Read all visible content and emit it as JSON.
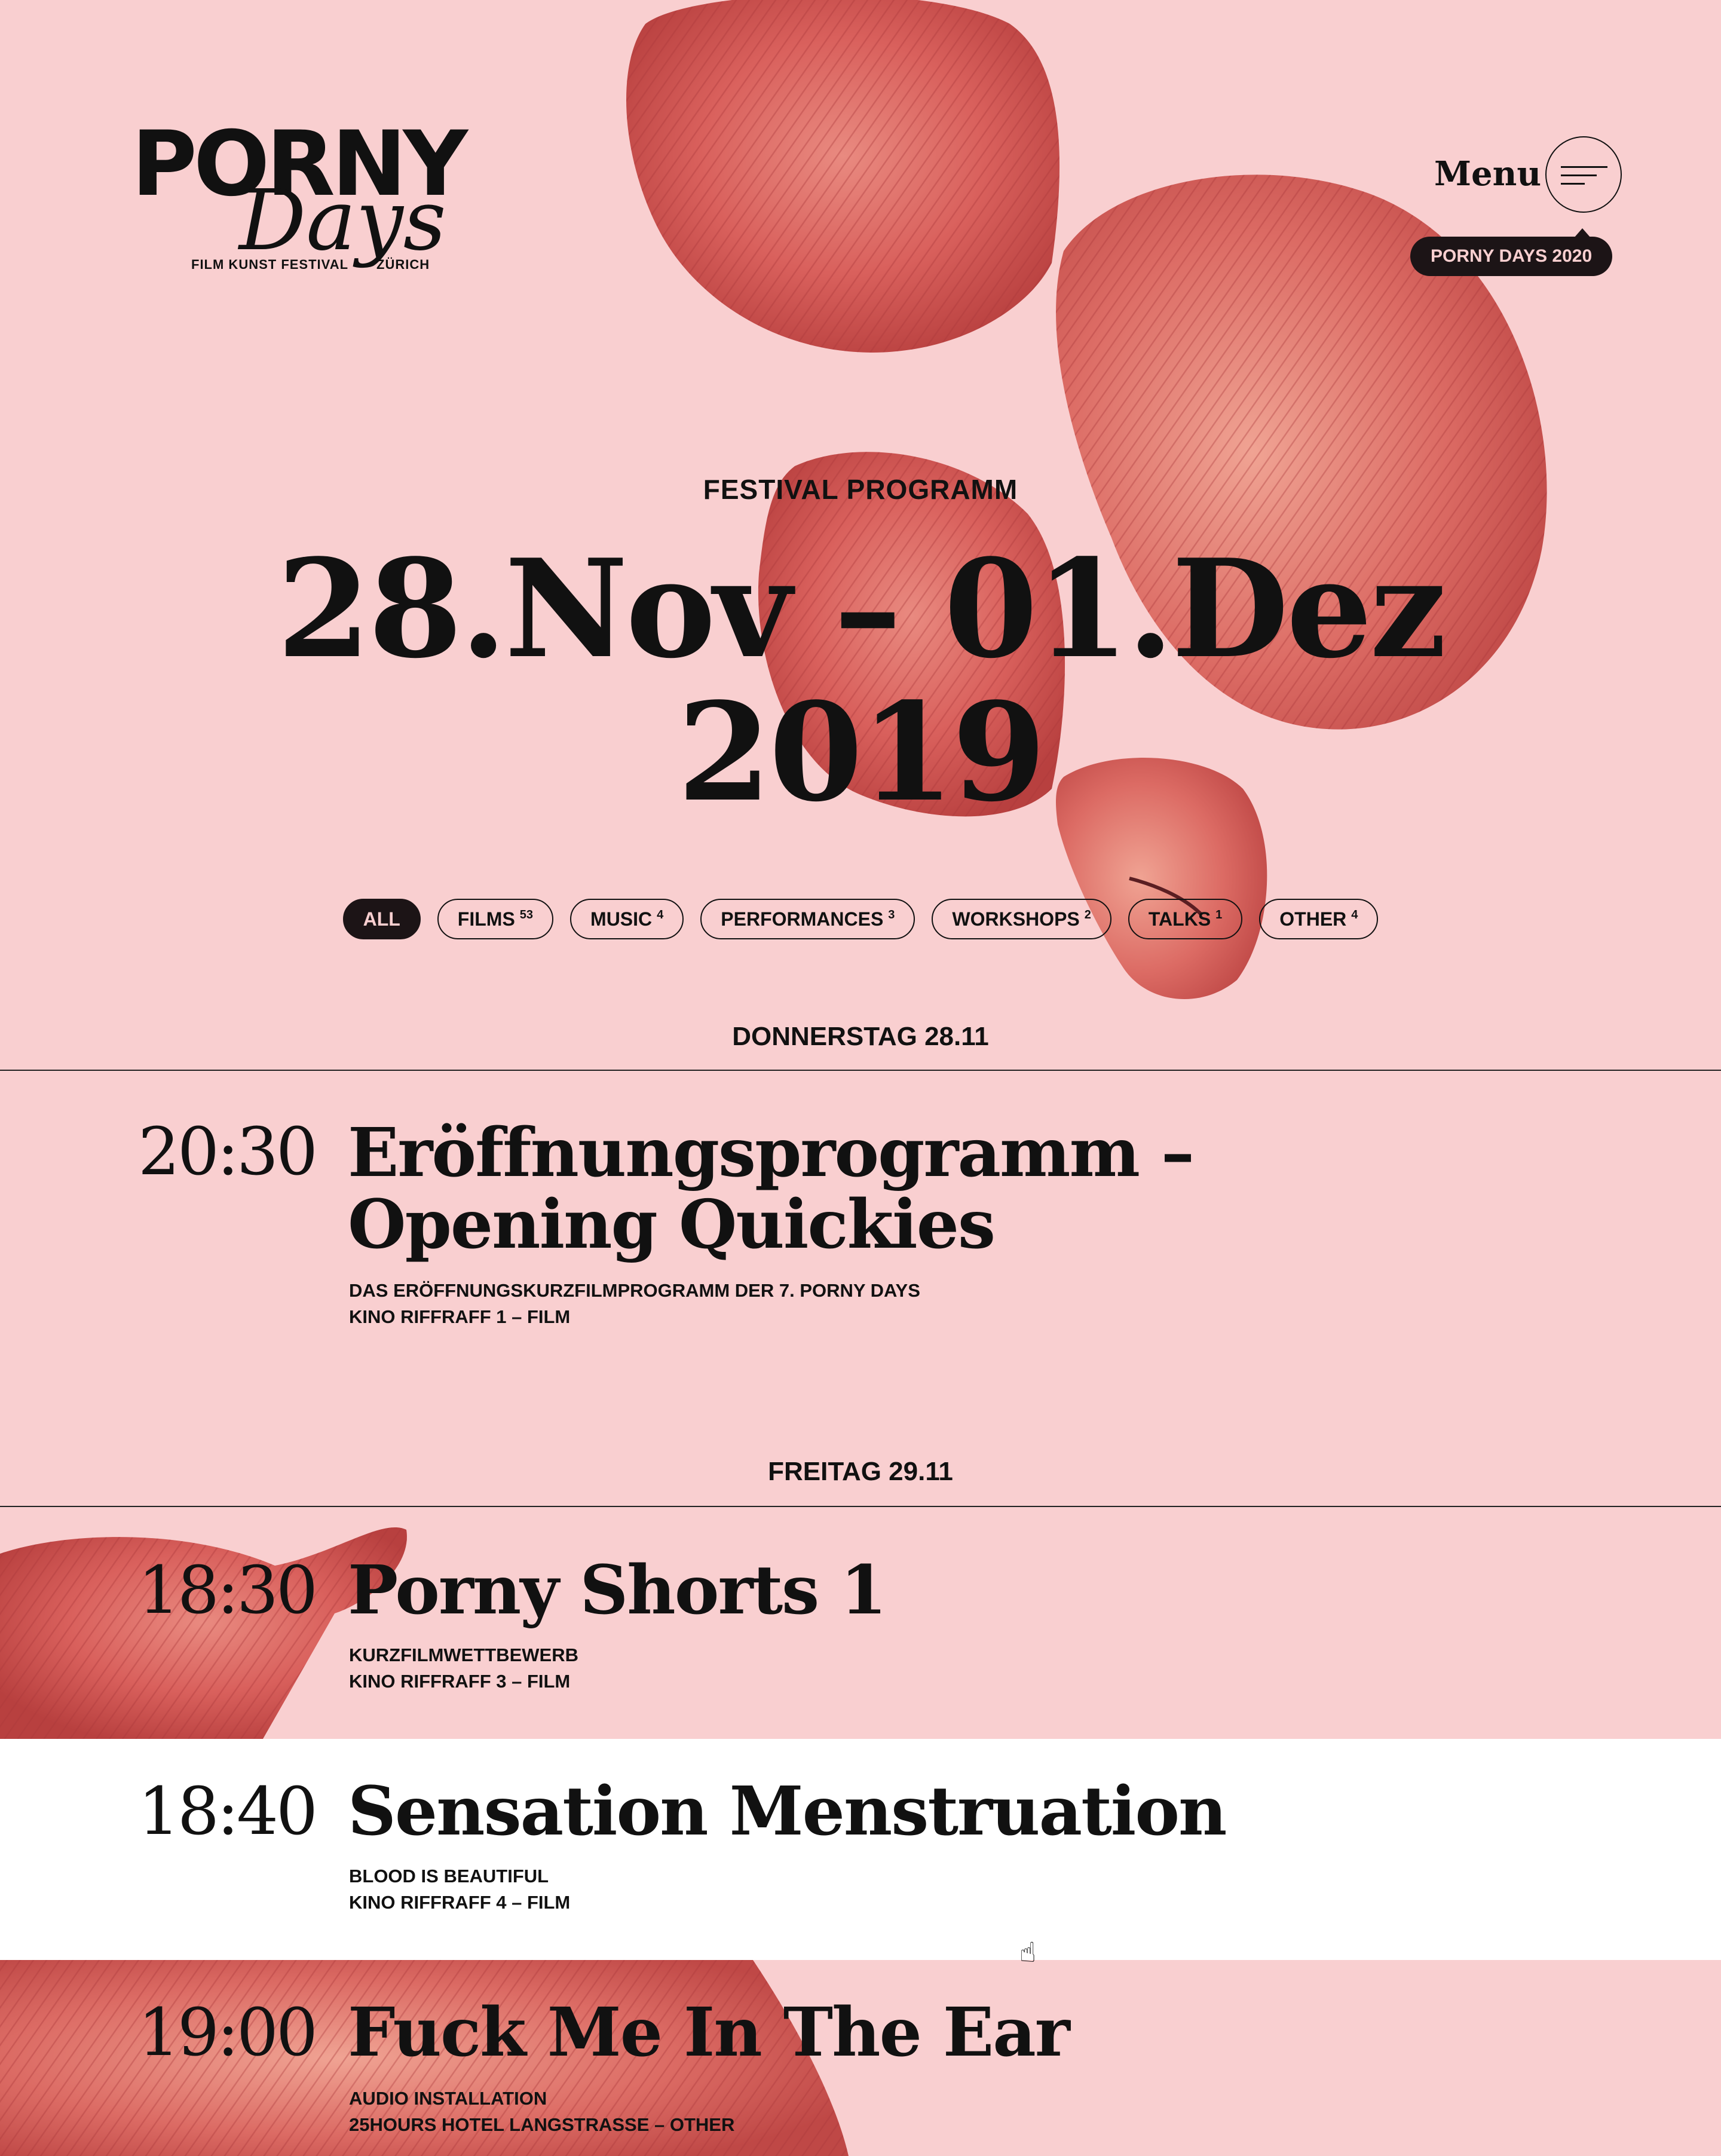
{
  "logo": {
    "wordmark": "PORNY",
    "script": "Days",
    "tagline_left": "FILM KUNST FESTIVAL",
    "tagline_right": "ZÜRICH"
  },
  "header": {
    "menu_label": "Menu",
    "menu_icon": "hamburger-icon",
    "badge": "PORNY DAYS 2020"
  },
  "hero": {
    "eyebrow": "FESTIVAL PROGRAMM",
    "title_line1": "28.Nov – 01.Dez",
    "title_line2": "2019"
  },
  "filters": [
    {
      "label": "ALL",
      "count": "",
      "active": true
    },
    {
      "label": "FILMS",
      "count": "53",
      "active": false
    },
    {
      "label": "MUSIC",
      "count": "4",
      "active": false
    },
    {
      "label": "PERFORMANCES",
      "count": "3",
      "active": false
    },
    {
      "label": "WORKSHOPS",
      "count": "2",
      "active": false
    },
    {
      "label": "TALKS",
      "count": "1",
      "active": false
    },
    {
      "label": "OTHER",
      "count": "4",
      "active": false
    }
  ],
  "days": [
    {
      "label": "DONNERSTAG 28.11",
      "events": [
        {
          "time": "20:30",
          "title": "Eröffnungsprogramm – Opening Quickies",
          "subtitle": "DAS ERÖFFNUNGSKURZFILMPROGRAMM DER 7. PORNY DAYS",
          "venue": "KINO RIFFRAFF 1  –  FILM"
        }
      ]
    },
    {
      "label": "FREITAG 29.11",
      "events": [
        {
          "time": "18:30",
          "title": "Porny Shorts 1",
          "subtitle": "KURZFILMWETTBEWERB",
          "venue": "KINO RIFFRAFF 3  –  FILM"
        },
        {
          "time": "18:40",
          "title": "Sensation Menstruation",
          "subtitle": "BLOOD IS BEAUTIFUL",
          "venue": "KINO RIFFRAFF 4  –  FILM"
        },
        {
          "time": "19:00",
          "title": "Fuck Me In The Ear",
          "subtitle": "AUDIO INSTALLATION",
          "venue": "25HOURS HOTEL LANGSTRASSE  –  OTHER"
        }
      ]
    }
  ],
  "colors": {
    "background": "#f9cfd0",
    "sculpture": "#d9605c",
    "ink": "#111111",
    "dark_pill": "#1c1416",
    "row_highlight": "#ffffff"
  },
  "icons": {
    "cursor": "hand-pointer-icon"
  }
}
